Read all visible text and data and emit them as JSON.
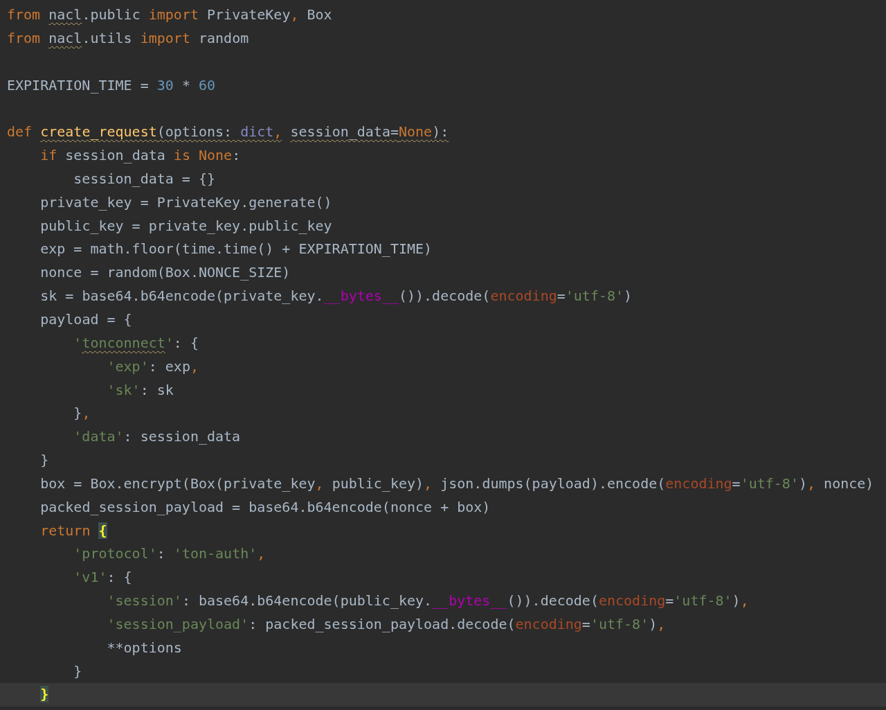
{
  "editor": {
    "lines": [
      {
        "current": false,
        "tokens": [
          {
            "text": "from ",
            "kind": "keyword"
          },
          {
            "text": "nacl",
            "warning": true
          },
          {
            "text": ".public "
          },
          {
            "text": "import",
            "kind": "keyword"
          },
          {
            "text": " PrivateKey"
          },
          {
            "text": ",",
            "kind": "keyword"
          },
          {
            "text": " Box"
          }
        ]
      },
      {
        "current": false,
        "tokens": [
          {
            "text": "from ",
            "kind": "keyword"
          },
          {
            "text": "nacl",
            "warning": true
          },
          {
            "text": ".utils "
          },
          {
            "text": "import",
            "kind": "keyword"
          },
          {
            "text": " random"
          }
        ]
      },
      {
        "current": false
      },
      {
        "current": false,
        "tokens": [
          {
            "text": "EXPIRATION_TIME = "
          },
          {
            "text": "30",
            "kind": "number"
          },
          {
            "text": " * "
          },
          {
            "text": "60",
            "kind": "number"
          }
        ]
      },
      {
        "current": false
      },
      {
        "current": false,
        "tokens": [
          {
            "text": "def ",
            "kind": "keyword"
          },
          {
            "text": "create_request",
            "kind": "function",
            "warning": true
          },
          {
            "text": "(options: ",
            "warning": true
          },
          {
            "text": "dict",
            "kind": "builtin",
            "warning": true
          },
          {
            "text": ",",
            "kind": "keyword",
            "warning": true
          },
          {
            "text": " session_data=",
            "warning": true
          },
          {
            "text": "None",
            "kind": "keyword",
            "warning": true
          },
          {
            "text": "):",
            "warning": true
          }
        ]
      },
      {
        "current": false,
        "tokens": [
          {
            "text": "    if",
            "kind": "keyword"
          },
          {
            "text": " session_data "
          },
          {
            "text": "is None",
            "kind": "keyword"
          },
          {
            "text": ":"
          }
        ]
      },
      {
        "current": false,
        "tokens": [
          {
            "text": "        session_data = {}"
          }
        ]
      },
      {
        "current": false,
        "tokens": [
          {
            "text": "    private_key = PrivateKey.generate()"
          }
        ]
      },
      {
        "current": false,
        "tokens": [
          {
            "text": "    public_key = private_key.public_key"
          }
        ]
      },
      {
        "current": false,
        "tokens": [
          {
            "text": "    exp = math.floor(time.time() + EXPIRATION_TIME)"
          }
        ]
      },
      {
        "current": false,
        "tokens": [
          {
            "text": "    nonce = random(Box.NONCE_SIZE)"
          }
        ]
      },
      {
        "current": false,
        "tokens": [
          {
            "text": "    sk = base64.b64encode(private_key."
          },
          {
            "text": "__bytes__",
            "kind": "dunder"
          },
          {
            "text": "()).decode("
          },
          {
            "text": "encoding",
            "kind": "param"
          },
          {
            "text": "="
          },
          {
            "text": "'utf-8'",
            "kind": "string"
          },
          {
            "text": ")"
          }
        ]
      },
      {
        "current": false,
        "tokens": [
          {
            "text": "    payload = {"
          }
        ]
      },
      {
        "current": false,
        "tokens": [
          {
            "text": "        '",
            "kind": "string"
          },
          {
            "text": "tonconnect",
            "kind": "string",
            "warning": true
          },
          {
            "text": "'",
            "kind": "string"
          },
          {
            "text": ": {"
          }
        ]
      },
      {
        "current": false,
        "tokens": [
          {
            "text": "            'exp'",
            "kind": "string"
          },
          {
            "text": ": exp"
          },
          {
            "text": ",",
            "kind": "keyword"
          }
        ]
      },
      {
        "current": false,
        "tokens": [
          {
            "text": "            'sk'",
            "kind": "string"
          },
          {
            "text": ": sk"
          }
        ]
      },
      {
        "current": false,
        "tokens": [
          {
            "text": "        }"
          },
          {
            "text": ",",
            "kind": "keyword"
          }
        ]
      },
      {
        "current": false,
        "tokens": [
          {
            "text": "        'data'",
            "kind": "string"
          },
          {
            "text": ": session_data"
          }
        ]
      },
      {
        "current": false,
        "tokens": [
          {
            "text": "    }"
          }
        ]
      },
      {
        "current": false,
        "tokens": [
          {
            "text": "    box = Box.encrypt(Box(private_key"
          },
          {
            "text": ",",
            "kind": "keyword"
          },
          {
            "text": " public_key)"
          },
          {
            "text": ",",
            "kind": "keyword"
          },
          {
            "text": " json.dumps(payload).encode("
          },
          {
            "text": "encoding",
            "kind": "param"
          },
          {
            "text": "="
          },
          {
            "text": "'utf-8'",
            "kind": "string"
          },
          {
            "text": ")"
          },
          {
            "text": ",",
            "kind": "keyword"
          },
          {
            "text": " nonce)"
          }
        ]
      },
      {
        "current": false,
        "tokens": [
          {
            "text": "    packed_session_payload = base64.b64encode(nonce + box)"
          }
        ]
      },
      {
        "current": false,
        "tokens": [
          {
            "text": "    return ",
            "kind": "keyword"
          },
          {
            "text": "{",
            "kind": "brace-match"
          }
        ]
      },
      {
        "current": false,
        "tokens": [
          {
            "text": "        'protocol'",
            "kind": "string"
          },
          {
            "text": ": "
          },
          {
            "text": "'ton-auth'",
            "kind": "string"
          },
          {
            "text": ",",
            "kind": "keyword"
          }
        ]
      },
      {
        "current": false,
        "tokens": [
          {
            "text": "        'v1'",
            "kind": "string"
          },
          {
            "text": ": {"
          }
        ]
      },
      {
        "current": false,
        "tokens": [
          {
            "text": "            'session'",
            "kind": "string"
          },
          {
            "text": ": base64.b64encode(public_key."
          },
          {
            "text": "__bytes__",
            "kind": "dunder"
          },
          {
            "text": "()).decode("
          },
          {
            "text": "encoding",
            "kind": "param"
          },
          {
            "text": "="
          },
          {
            "text": "'utf-8'",
            "kind": "string"
          },
          {
            "text": ")"
          },
          {
            "text": ",",
            "kind": "keyword"
          }
        ]
      },
      {
        "current": false,
        "tokens": [
          {
            "text": "            'session_payload'",
            "kind": "string"
          },
          {
            "text": ": packed_session_payload.decode("
          },
          {
            "text": "encoding",
            "kind": "param"
          },
          {
            "text": "="
          },
          {
            "text": "'utf-8'",
            "kind": "string"
          },
          {
            "text": ")"
          },
          {
            "text": ",",
            "kind": "keyword"
          }
        ]
      },
      {
        "current": false,
        "tokens": [
          {
            "text": "            **options"
          }
        ]
      },
      {
        "current": false,
        "tokens": [
          {
            "text": "        }"
          }
        ]
      },
      {
        "current": true,
        "tokens": [
          {
            "text": "    }",
            "kind": "brace-match"
          }
        ]
      }
    ]
  }
}
